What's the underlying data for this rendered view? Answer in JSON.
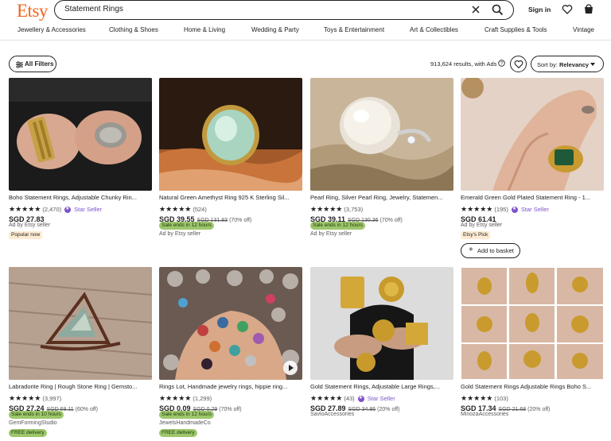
{
  "header": {
    "logo": "Etsy",
    "search_value": "Statement Rings",
    "signin": "Sign in"
  },
  "categories": [
    "Jewellery & Accessories",
    "Clothing & Shoes",
    "Home & Living",
    "Wedding & Party",
    "Toys & Entertainment",
    "Art & Collectibles",
    "Craft Supplies & Tools",
    "Vintage"
  ],
  "toolbar": {
    "filters_label": "All Filters",
    "results_text": "913,624 results, with Ads",
    "sort_prefix": "Sort by: ",
    "sort_value": "Relevancy"
  },
  "colors": {
    "brand": "#f1641e",
    "star_seller": "#7d52cb",
    "sale_badge": "#9ec66c"
  },
  "products": [
    {
      "title": "Boho Statement Rings, Adjustable Chunky Rin...",
      "stars": "★★★★★",
      "count": "(2,470)",
      "star_seller": "Star Seller",
      "price": "SGD 27.83",
      "meta": "Ad by Etsy seller",
      "badge": "Popular now"
    },
    {
      "title": "Natural Green Amethyst Ring 925 K Sterling Sil...",
      "stars": "★★★★★",
      "count": "(524)",
      "price": "SGD 39.55",
      "old_price": "SGD 131.83",
      "discount": "(70% off)",
      "sale": "Sale ends in 12 hours",
      "meta": "Ad by Etsy seller"
    },
    {
      "title": "Pearl Ring, Silver Pearl Ring, Jewelry, Statemen...",
      "stars": "★★★★★",
      "count": "(3,753)",
      "price": "SGD 39.11",
      "old_price": "SGD 130.36",
      "discount": "(70% off)",
      "sale": "Sale ends in 12 hours",
      "meta": "Ad by Etsy seller"
    },
    {
      "title": "Emerald Green Gold Plated Statement Ring - 1...",
      "stars": "★★★★★",
      "count": "(195)",
      "star_seller": "Star Seller",
      "price": "SGD 61.41",
      "meta": "Ad by Etsy seller",
      "badge": "Etsy's Pick",
      "button": "Add to basket"
    },
    {
      "title": "Labradorite Ring | Rough Stone Ring | Gemsto...",
      "stars": "★★★★★",
      "count": "(3,997)",
      "price": "SGD 27.24",
      "old_price": "SGD 68.11",
      "discount": "(60% off)",
      "sale": "Sale ends in 10 hours",
      "meta": "GemFormingStudio",
      "delivery": "FREE delivery"
    },
    {
      "title": "Rings Lot, Handmade jewelry rings, hippie ring...",
      "stars": "★★★★★",
      "count": "(1,299)",
      "price": "SGD 0.09",
      "old_price": "SGD 0.29",
      "discount": "(70% off)",
      "sale": "Sale ends in 12 hours",
      "meta": "JewelsHandmadeCo",
      "delivery": "FREE delivery"
    },
    {
      "title": "Gold Statement Rings, Adjustable Large Rings,...",
      "stars": "★★★★★",
      "count": "(43)",
      "star_seller": "Star Seller",
      "price": "SGD 27.89",
      "old_price": "SGD 34.86",
      "discount": "(20% off)",
      "meta": "SavloAccessories"
    },
    {
      "title": "Gold Statement Rings Adjustable Rings Boho S...",
      "stars": "★★★★★",
      "count": "(103)",
      "price": "SGD 17.34",
      "old_price": "SGD 21.68",
      "discount": "(20% off)",
      "meta": "MinozaAccessories"
    }
  ]
}
